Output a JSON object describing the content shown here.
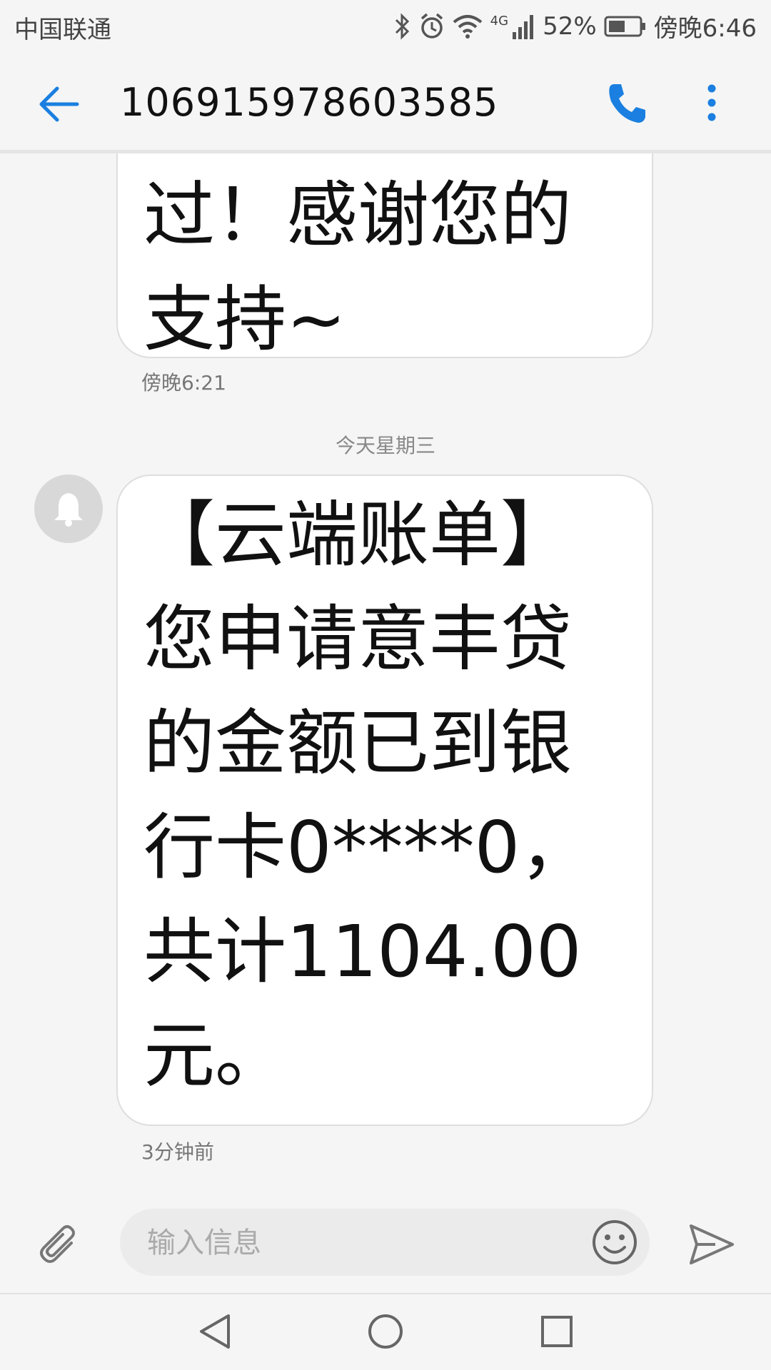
{
  "status_bar": {
    "carrier": "中国联通",
    "network": "4G",
    "battery": "52%",
    "time": "傍晚6:46",
    "icons": [
      "bluetooth-icon",
      "alarm-icon",
      "wifi-icon",
      "signal-icon",
      "battery-icon"
    ]
  },
  "header": {
    "title": "106915978603585",
    "icons": [
      "back-arrow-icon",
      "phone-call-icon",
      "more-vert-icon"
    ]
  },
  "messages": [
    {
      "text": "过！感谢您的支持~",
      "time": "傍晚6:21"
    },
    {
      "date_divider": "今天星期三",
      "text": "【云端账单】您申请意丰贷的金额已到银行卡0****0，共计1104.00元。",
      "time": "3分钟前",
      "avatar_icon": "notification-bell-icon"
    }
  ],
  "composer": {
    "placeholder": "输入信息",
    "icons": [
      "attachment-icon",
      "emoji-icon",
      "send-icon"
    ]
  },
  "nav_bar": {
    "icons": [
      "nav-back-icon",
      "nav-home-icon",
      "nav-recents-icon"
    ]
  },
  "colors": {
    "accent": "#1a7fe0",
    "background": "#f5f5f5",
    "bubble": "#ffffff"
  }
}
